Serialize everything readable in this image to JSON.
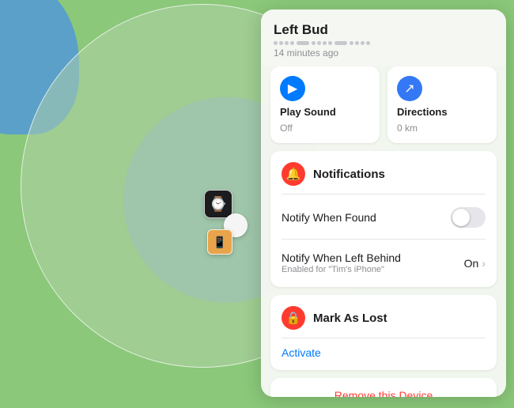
{
  "map": {
    "bg_color": "#8bc87a"
  },
  "panel": {
    "title": "Left Bud",
    "time": "14 minutes ago",
    "actions": [
      {
        "id": "play-sound",
        "label": "Play Sound",
        "sublabel": "Off",
        "icon": "▶"
      },
      {
        "id": "directions",
        "label": "Directions",
        "sublabel": "0 km",
        "icon": "↗"
      }
    ],
    "notifications": {
      "section_title": "Notifications",
      "notify_when_found": {
        "label": "Notify When Found",
        "enabled": false
      },
      "notify_when_left_behind": {
        "label": "Notify When Left Behind",
        "status": "On",
        "sublabel": "Enabled for \"Tim's iPhone\""
      }
    },
    "mark_as_lost": {
      "title": "Mark As Lost",
      "activate_label": "Activate"
    },
    "remove_device": {
      "label": "Remove this Device"
    }
  }
}
